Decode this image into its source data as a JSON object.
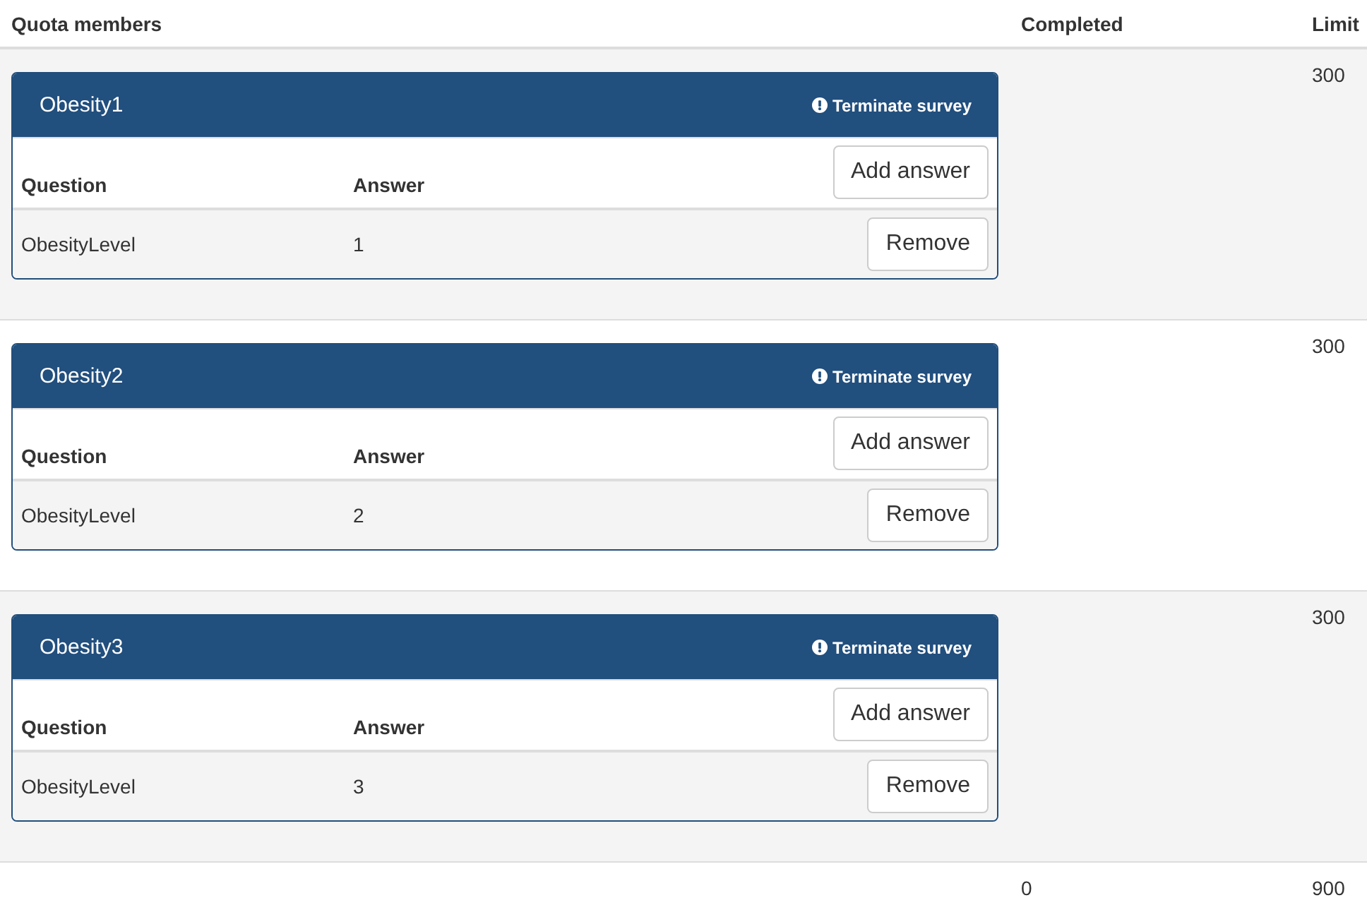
{
  "table": {
    "columns": [
      "Quota members",
      "Completed",
      "Limit"
    ],
    "rows": [
      {
        "quota": {
          "title": "Obesity1",
          "action": "Terminate survey",
          "member_columns": [
            "Question",
            "Answer"
          ],
          "add_button": "Add answer",
          "members": [
            {
              "question": "ObesityLevel",
              "answer": "1",
              "remove_button": "Remove"
            }
          ]
        },
        "limit": "300"
      },
      {
        "quota": {
          "title": "Obesity2",
          "action": "Terminate survey",
          "member_columns": [
            "Question",
            "Answer"
          ],
          "add_button": "Add answer",
          "members": [
            {
              "question": "ObesityLevel",
              "answer": "2",
              "remove_button": "Remove"
            }
          ]
        },
        "limit": "300"
      },
      {
        "quota": {
          "title": "Obesity3",
          "action": "Terminate survey",
          "member_columns": [
            "Question",
            "Answer"
          ],
          "add_button": "Add answer",
          "members": [
            {
              "question": "ObesityLevel",
              "answer": "3",
              "remove_button": "Remove"
            }
          ]
        },
        "limit": "300"
      }
    ],
    "total": {
      "completed": "0",
      "limit": "900"
    }
  }
}
